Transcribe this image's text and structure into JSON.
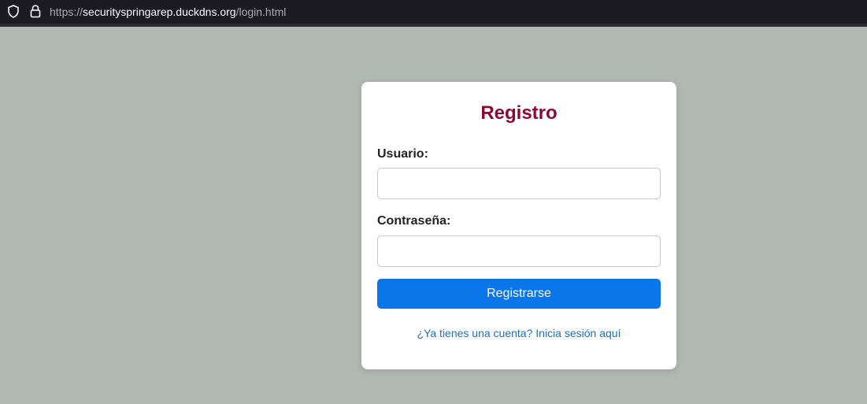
{
  "browser": {
    "url_scheme": "https://",
    "url_host": "securityspringarep.duckdns.org",
    "url_path": "/login.html",
    "icons": [
      "shield-icon",
      "lock-icon"
    ]
  },
  "form": {
    "title": "Registro",
    "username_label": "Usuario:",
    "username_value": "",
    "password_label": "Contraseña:",
    "password_value": "",
    "submit_label": "Registrarse",
    "login_link": "¿Ya tienes una cuenta? Inicia sesión aquí"
  },
  "colors": {
    "page_background": "#afb8b1",
    "title": "#8b0a2f",
    "button": "#0b76ea",
    "link": "#1a6fc2"
  }
}
